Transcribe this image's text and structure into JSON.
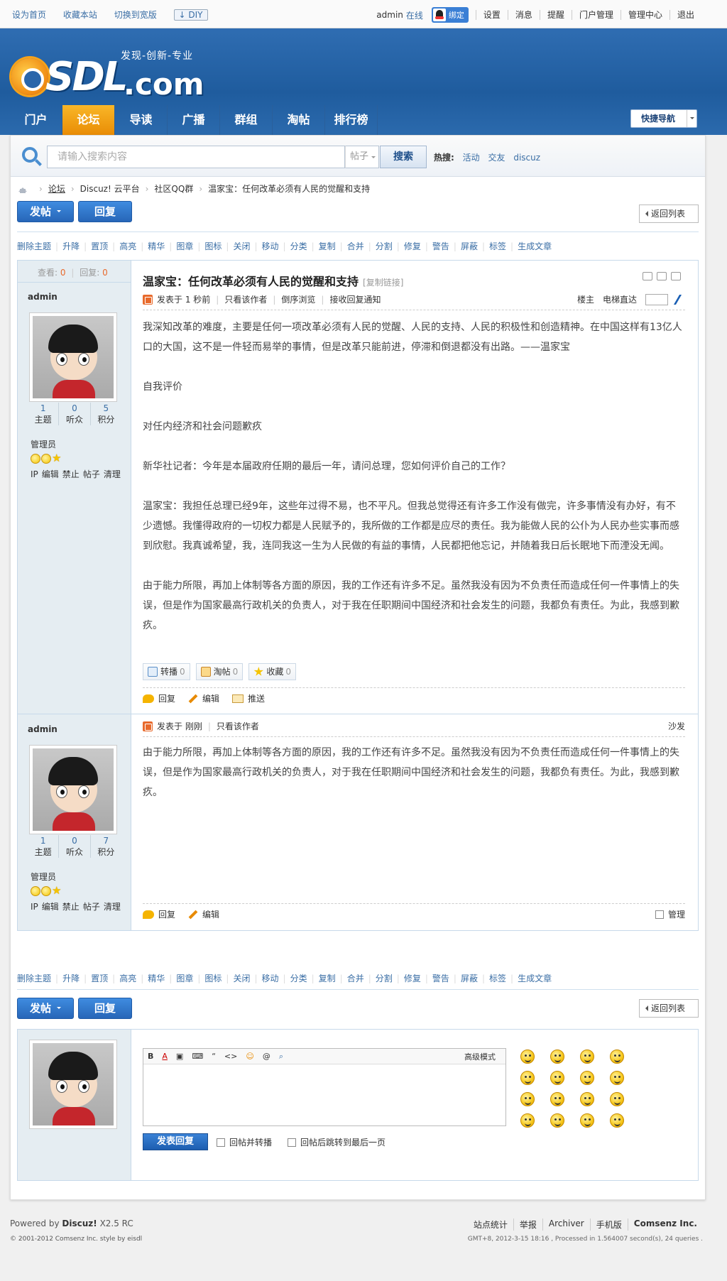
{
  "topbar": {
    "links": [
      "设为首页",
      "收藏本站",
      "切换到宽版"
    ],
    "diy": "DIY",
    "user": "admin",
    "status": "在线",
    "bind": "绑定",
    "menu": [
      "设置",
      "消息",
      "提醒",
      "门户管理",
      "管理中心",
      "退出"
    ]
  },
  "logo": {
    "text1": "eSDL",
    "text2": ".com",
    "slogan": "发现-创新-专业"
  },
  "nav": {
    "items": [
      "门户",
      "论坛",
      "导读",
      "广播",
      "群组",
      "淘帖",
      "排行榜"
    ],
    "active": 1,
    "quicknav": "快捷导航"
  },
  "search": {
    "placeholder": "请输入搜索内容",
    "type": "帖子",
    "button": "搜索",
    "hot_label": "热搜:",
    "hot": [
      "活动",
      "交友",
      "discuz"
    ]
  },
  "breadcrumb": [
    "论坛",
    "Discuz! 云平台",
    "社区QQ群",
    "温家宝：任何改革必须有人民的觉醒和支持"
  ],
  "buttons": {
    "post": "发帖",
    "reply": "回复",
    "back": "返回列表"
  },
  "modtools": [
    "删除主题",
    "升降",
    "置顶",
    "高亮",
    "精华",
    "图章",
    "图标",
    "关闭",
    "移动",
    "分类",
    "复制",
    "合并",
    "分割",
    "修复",
    "警告",
    "屏蔽",
    "标签",
    "生成文章"
  ],
  "thread": {
    "views_label": "查看:",
    "views": "0",
    "replies_label": "回复:",
    "replies": "0",
    "title": "温家宝：任何改革必须有人民的觉醒和支持",
    "copy_link": "[复制链接]"
  },
  "post1": {
    "author": "admin",
    "stats": [
      {
        "v": "1",
        "l": "主题"
      },
      {
        "v": "0",
        "l": "听众"
      },
      {
        "v": "5",
        "l": "积分"
      }
    ],
    "group": "管理员",
    "admin_links": [
      "IP",
      "编辑",
      "禁止",
      "帖子",
      "清理"
    ],
    "meta": {
      "posted": "发表于 1 秒前",
      "only_author": "只看该作者",
      "reverse": "倒序浏览",
      "notify": "接收回复通知",
      "floor": "楼主",
      "jump": "电梯直达"
    },
    "paragraphs": [
      "我深知改革的难度，主要是任何一项改革必须有人民的觉醒、人民的支持、人民的积极性和创造精神。在中国这样有13亿人口的大国，这不是一件轻而易举的事情，但是改革只能前进，停滞和倒退都没有出路。——温家宝",
      "自我评价",
      "对任内经济和社会问题歉疚",
      "新华社记者：今年是本届政府任期的最后一年，请问总理，您如何评价自己的工作？",
      "温家宝：我担任总理已经9年，这些年过得不易，也不平凡。但我总觉得还有许多工作没有做完，许多事情没有办好，有不少遗憾。我懂得政府的一切权力都是人民赋予的，我所做的工作都是应尽的责任。我为能做人民的公仆为人民办些实事而感到欣慰。我真诚希望，我，连同我这一生为人民做的有益的事情，人民都把他忘记，并随着我日后长眠地下而湮没无闻。",
      "由于能力所限，再加上体制等各方面的原因，我的工作还有许多不足。虽然我没有因为不负责任而造成任何一件事情上的失误，但是作为国家最高行政机关的负责人，对于我在任职期间中国经济和社会发生的问题，我都负有责任。为此，我感到歉疚。"
    ],
    "share": [
      {
        "label": "转播",
        "count": "0"
      },
      {
        "label": "淘帖",
        "count": "0"
      },
      {
        "label": "收藏",
        "count": "0"
      }
    ],
    "actions": [
      "回复",
      "编辑",
      "推送"
    ]
  },
  "post2": {
    "author": "admin",
    "stats": [
      {
        "v": "1",
        "l": "主题"
      },
      {
        "v": "0",
        "l": "听众"
      },
      {
        "v": "7",
        "l": "积分"
      }
    ],
    "group": "管理员",
    "admin_links": [
      "IP",
      "编辑",
      "禁止",
      "帖子",
      "清理"
    ],
    "meta": {
      "posted": "发表于 刚刚",
      "only_author": "只看该作者",
      "floor": "沙发"
    },
    "paragraphs": [
      "由于能力所限，再加上体制等各方面的原因，我的工作还有许多不足。虽然我没有因为不负责任而造成任何一件事情上的失误，但是作为国家最高行政机关的负责人，对于我在任职期间中国经济和社会发生的问题，我都负有责任。为此，我感到歉疚。"
    ],
    "actions": [
      "回复",
      "编辑"
    ],
    "manage": "管理"
  },
  "reply_box": {
    "toolbar": [
      "B",
      "A",
      "▣",
      "⌨",
      "“",
      "<>",
      "☺",
      "@",
      "⌕"
    ],
    "advanced": "高级模式",
    "submit": "发表回复",
    "opt1": "回帖并转播",
    "opt2": "回帖后跳转到最后一页"
  },
  "footer": {
    "powered": "Powered by",
    "brand": "Discuz!",
    "version": "X2.5 RC",
    "copyright": "© 2001-2012 Comsenz Inc. style by eisdl",
    "links": [
      "站点统计",
      "举报",
      "Archiver",
      "手机版",
      "Comsenz Inc."
    ],
    "stats": "GMT+8, 2012-3-15 18:16 , Processed in 1.564007 second(s), 24 queries ."
  }
}
